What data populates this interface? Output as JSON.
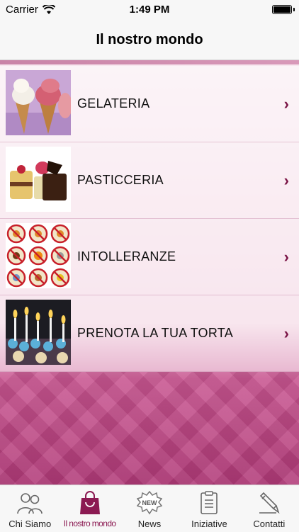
{
  "status_bar": {
    "carrier": "Carrier",
    "time": "1:49 PM"
  },
  "nav": {
    "title": "Il nostro mondo"
  },
  "list": [
    {
      "label": "GELATERIA"
    },
    {
      "label": "PASTICCERIA"
    },
    {
      "label": "INTOLLERANZE"
    },
    {
      "label": "PRENOTA LA TUA TORTA"
    }
  ],
  "tabs": [
    {
      "label": "Chi Siamo",
      "icon": "people-icon"
    },
    {
      "label": "Il nostro mondo",
      "icon": "bag-icon",
      "active": true
    },
    {
      "label": "News",
      "icon": "new-badge-icon",
      "badge_text": "NEW"
    },
    {
      "label": "Iniziative",
      "icon": "document-icon"
    },
    {
      "label": "Contatti",
      "icon": "pencil-icon"
    }
  ],
  "colors": {
    "accent": "#8b1a52",
    "chevron": "#7a1446"
  }
}
